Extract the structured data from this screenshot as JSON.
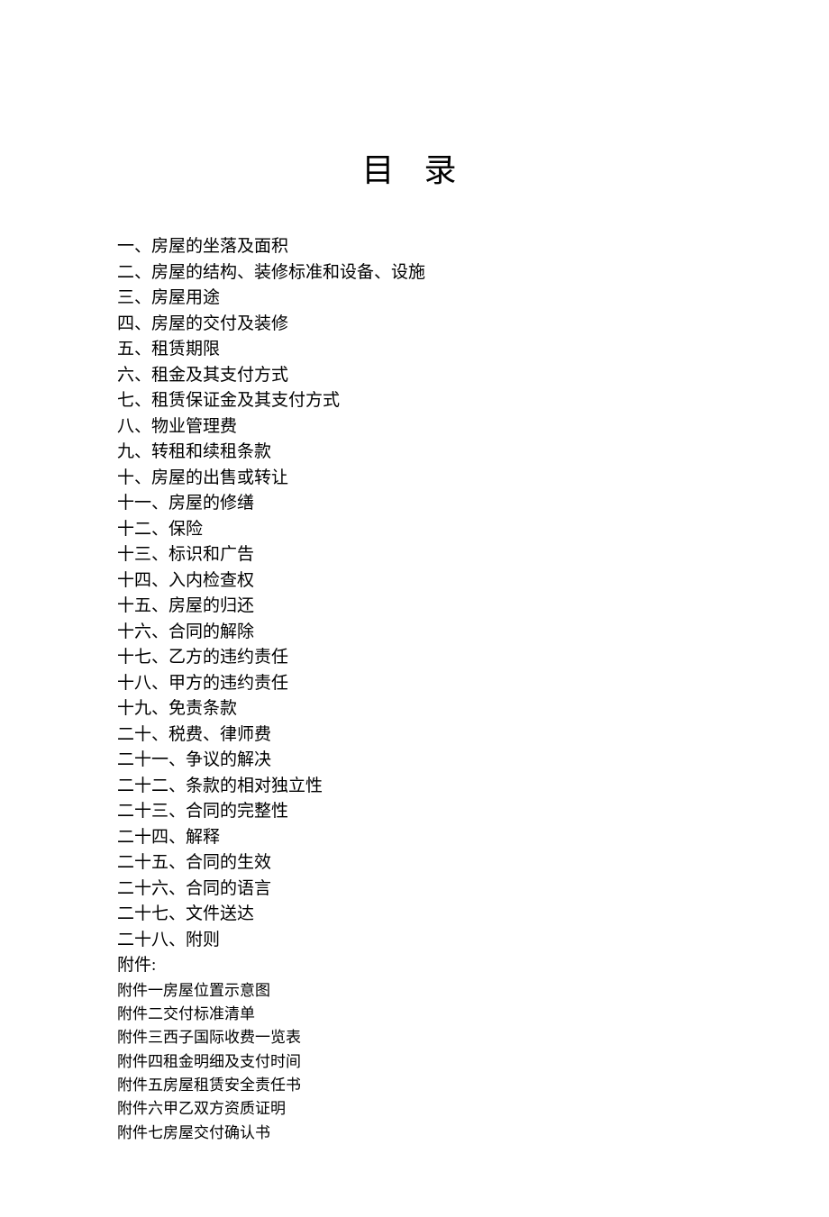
{
  "title": "目 录",
  "toc": [
    "一、房屋的坐落及面积",
    "二、房屋的结构、装修标准和设备、设施",
    "三、房屋用途",
    "四、房屋的交付及装修",
    "五、租赁期限",
    "六、租金及其支付方式",
    "七、租赁保证金及其支付方式",
    "八、物业管理费",
    "九、转租和续租条款",
    "十、房屋的出售或转让",
    "十一、房屋的修缮",
    "十二、保险",
    "十三、标识和广告",
    "十四、入内检查权",
    "十五、房屋的归还",
    "十六、合同的解除",
    "十七、乙方的违约责任",
    "十八、甲方的违约责任",
    "十九、免责条款",
    "二十、税费、律师费",
    "二十一、争议的解决",
    "二十二、条款的相对独立性",
    "二十三、合同的完整性",
    "二十四、解释",
    "二十五、合同的生效",
    "二十六、合同的语言",
    "二十七、文件送达",
    "二十八、附则"
  ],
  "appendix_header": "附件:",
  "appendix": [
    "附件一房屋位置示意图",
    "附件二交付标准清单",
    "附件三西子国际收费一览表",
    "附件四租金明细及支付时间",
    "附件五房屋租赁安全责任书",
    "附件六甲乙双方资质证明",
    "附件七房屋交付确认书"
  ]
}
